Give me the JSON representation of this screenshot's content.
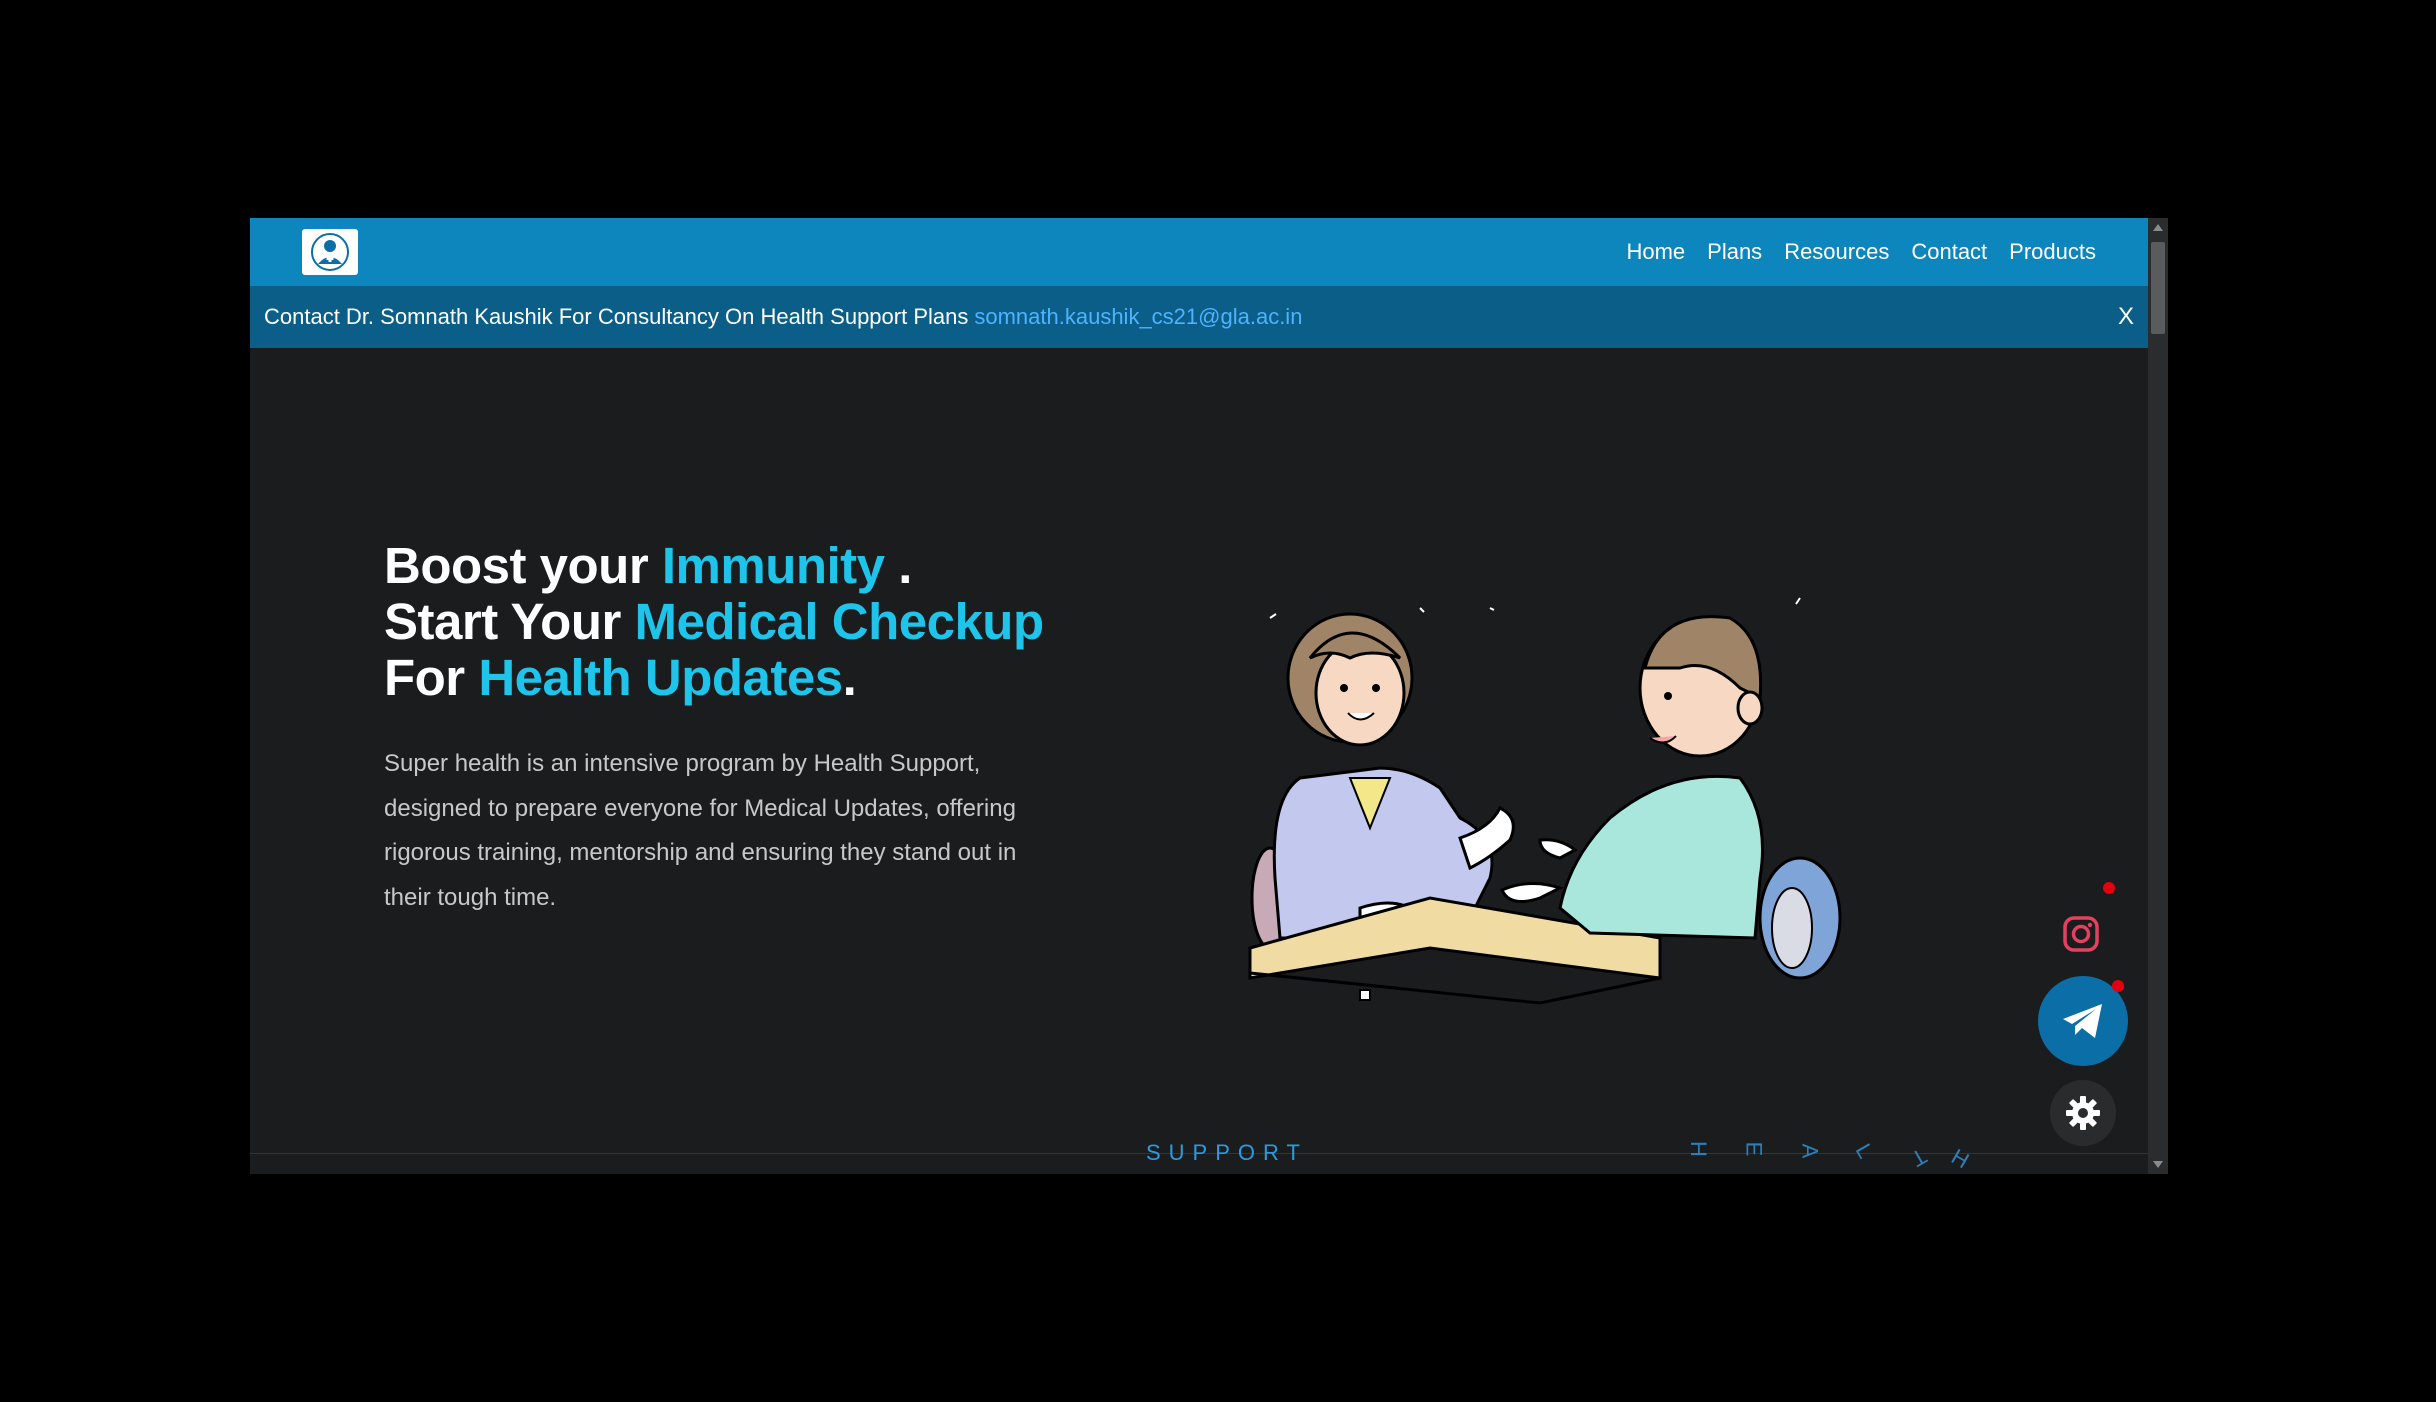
{
  "nav": {
    "logo_icon": "doctor-avatar-icon",
    "links": [
      "Home",
      "Plans",
      "Resources",
      "Contact",
      "Products"
    ]
  },
  "announcement": {
    "text": "Contact Dr. Somnath Kaushik For Consultancy On Health Support Plans",
    "email": "somnath.kaushik_cs21@gla.ac.in",
    "close_label": "X"
  },
  "hero": {
    "line1_plain": "Boost your ",
    "line1_highlight": "Immunity",
    "line1_end": " .",
    "line2_plain": "Start Your ",
    "line2_highlight": "Medical Checkup",
    "line3_plain": "For ",
    "line3_highlight": "Health Updates",
    "line3_end": ".",
    "description": "Super health is an intensive program by Health Support, designed to prepare everyone for Medical Updates, offering rigorous training, mentorship and ensuring they stand out in their tough time."
  },
  "footer_anim": {
    "support": "SUPPORT",
    "healthy_letters": [
      "H",
      "E",
      "A",
      "L",
      "T",
      "H"
    ]
  },
  "colors": {
    "nav_bg": "#0c86bd",
    "announce_bg": "#0a5e87",
    "page_bg": "#1b1c1e",
    "highlight": "#1ec4ea",
    "telegram": "#0c6ea6",
    "instagram": "#e4405f"
  },
  "floating": {
    "instagram_icon": "instagram-icon",
    "telegram_icon": "telegram-icon",
    "theme_icon": "gear-icon"
  }
}
